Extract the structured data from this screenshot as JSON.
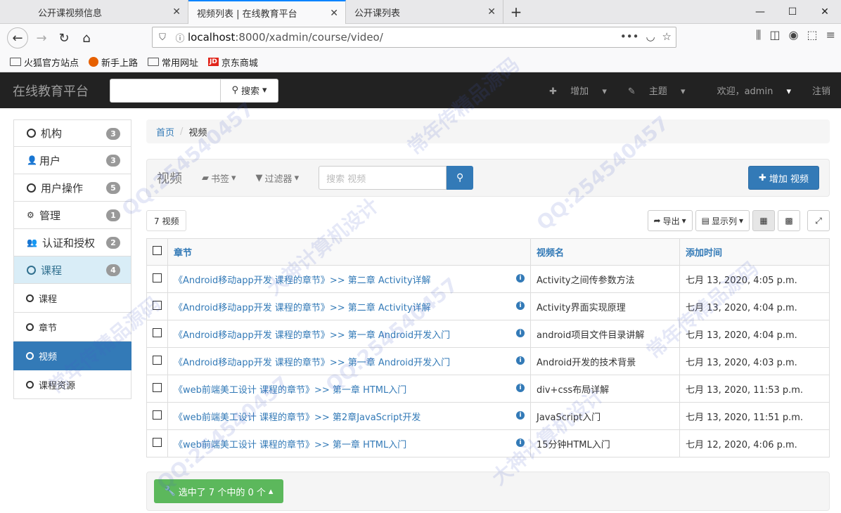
{
  "browser": {
    "tabs": [
      {
        "label": "公开课视频信息"
      },
      {
        "label": "视频列表 | 在线教育平台"
      },
      {
        "label": "公开课列表"
      }
    ],
    "url_host": "localhost",
    "url_path": ":8000/xadmin/course/video/",
    "bookmarks": [
      "火狐官方站点",
      "新手上路",
      "常用网址",
      "京东商城"
    ]
  },
  "topbar": {
    "brand": "在线教育平台",
    "search_label": "搜索",
    "menu": {
      "add": "增加",
      "theme": "主题",
      "welcome": "欢迎，admin",
      "logout": "注销"
    }
  },
  "sidebar": {
    "groups": [
      {
        "label": "机构",
        "count": "3",
        "icon": "circle-icon"
      },
      {
        "label": "用户",
        "count": "3",
        "icon": "user-icon"
      },
      {
        "label": "用户操作",
        "count": "5",
        "icon": "circle-icon"
      },
      {
        "label": "管理",
        "count": "1",
        "icon": "gear-icon"
      },
      {
        "label": "认证和授权",
        "count": "2",
        "icon": "users-icon"
      },
      {
        "label": "课程",
        "count": "4",
        "icon": "circle-icon"
      }
    ],
    "sub_items": [
      "课程",
      "章节",
      "视频",
      "课程资源"
    ]
  },
  "breadcrumb": {
    "home": "首页",
    "current": "视频"
  },
  "toolbar": {
    "title": "视频",
    "bookmarks_label": "书签",
    "filter_label": "过滤器",
    "search_placeholder": "搜索 视频",
    "add_label": "增加 视频"
  },
  "list": {
    "count_label": "7 视频",
    "export_label": "导出",
    "columns_label": "显示列",
    "headers": [
      "章节",
      "视频名",
      "添加时间"
    ],
    "rows": [
      {
        "chapter": "《Android移动app开发 课程的章节》>> 第二章 Activity详解",
        "name": "Activity之间传参数方法",
        "time": "七月 13, 2020, 4:05 p.m."
      },
      {
        "chapter": "《Android移动app开发 课程的章节》>> 第二章 Activity详解",
        "name": "Activity界面实现原理",
        "time": "七月 13, 2020, 4:04 p.m."
      },
      {
        "chapter": "《Android移动app开发 课程的章节》>> 第一章 Android开发入门",
        "name": "android项目文件目录讲解",
        "time": "七月 13, 2020, 4:04 p.m."
      },
      {
        "chapter": "《Android移动app开发 课程的章节》>> 第一章 Android开发入门",
        "name": "Android开发的技术背景",
        "time": "七月 13, 2020, 4:03 p.m."
      },
      {
        "chapter": "《web前端美工设计 课程的章节》>> 第一章 HTML入门",
        "name": "div+css布局详解",
        "time": "七月 13, 2020, 11:53 p.m."
      },
      {
        "chapter": "《web前端美工设计 课程的章节》>> 第2章JavaScript开发",
        "name": "JavaScript入门",
        "time": "七月 13, 2020, 11:51 p.m."
      },
      {
        "chapter": "《web前端美工设计 课程的章节》>> 第一章 HTML入门",
        "name": "15分钟HTML入门",
        "time": "七月 12, 2020, 4:06 p.m."
      }
    ]
  },
  "actions": {
    "selected_label": "选中了 7 个中的 0 个"
  },
  "watermark": {
    "qq": "QQ:254540457",
    "cn1": "大神计算机设计",
    "cn2": "常年传精品源码"
  }
}
